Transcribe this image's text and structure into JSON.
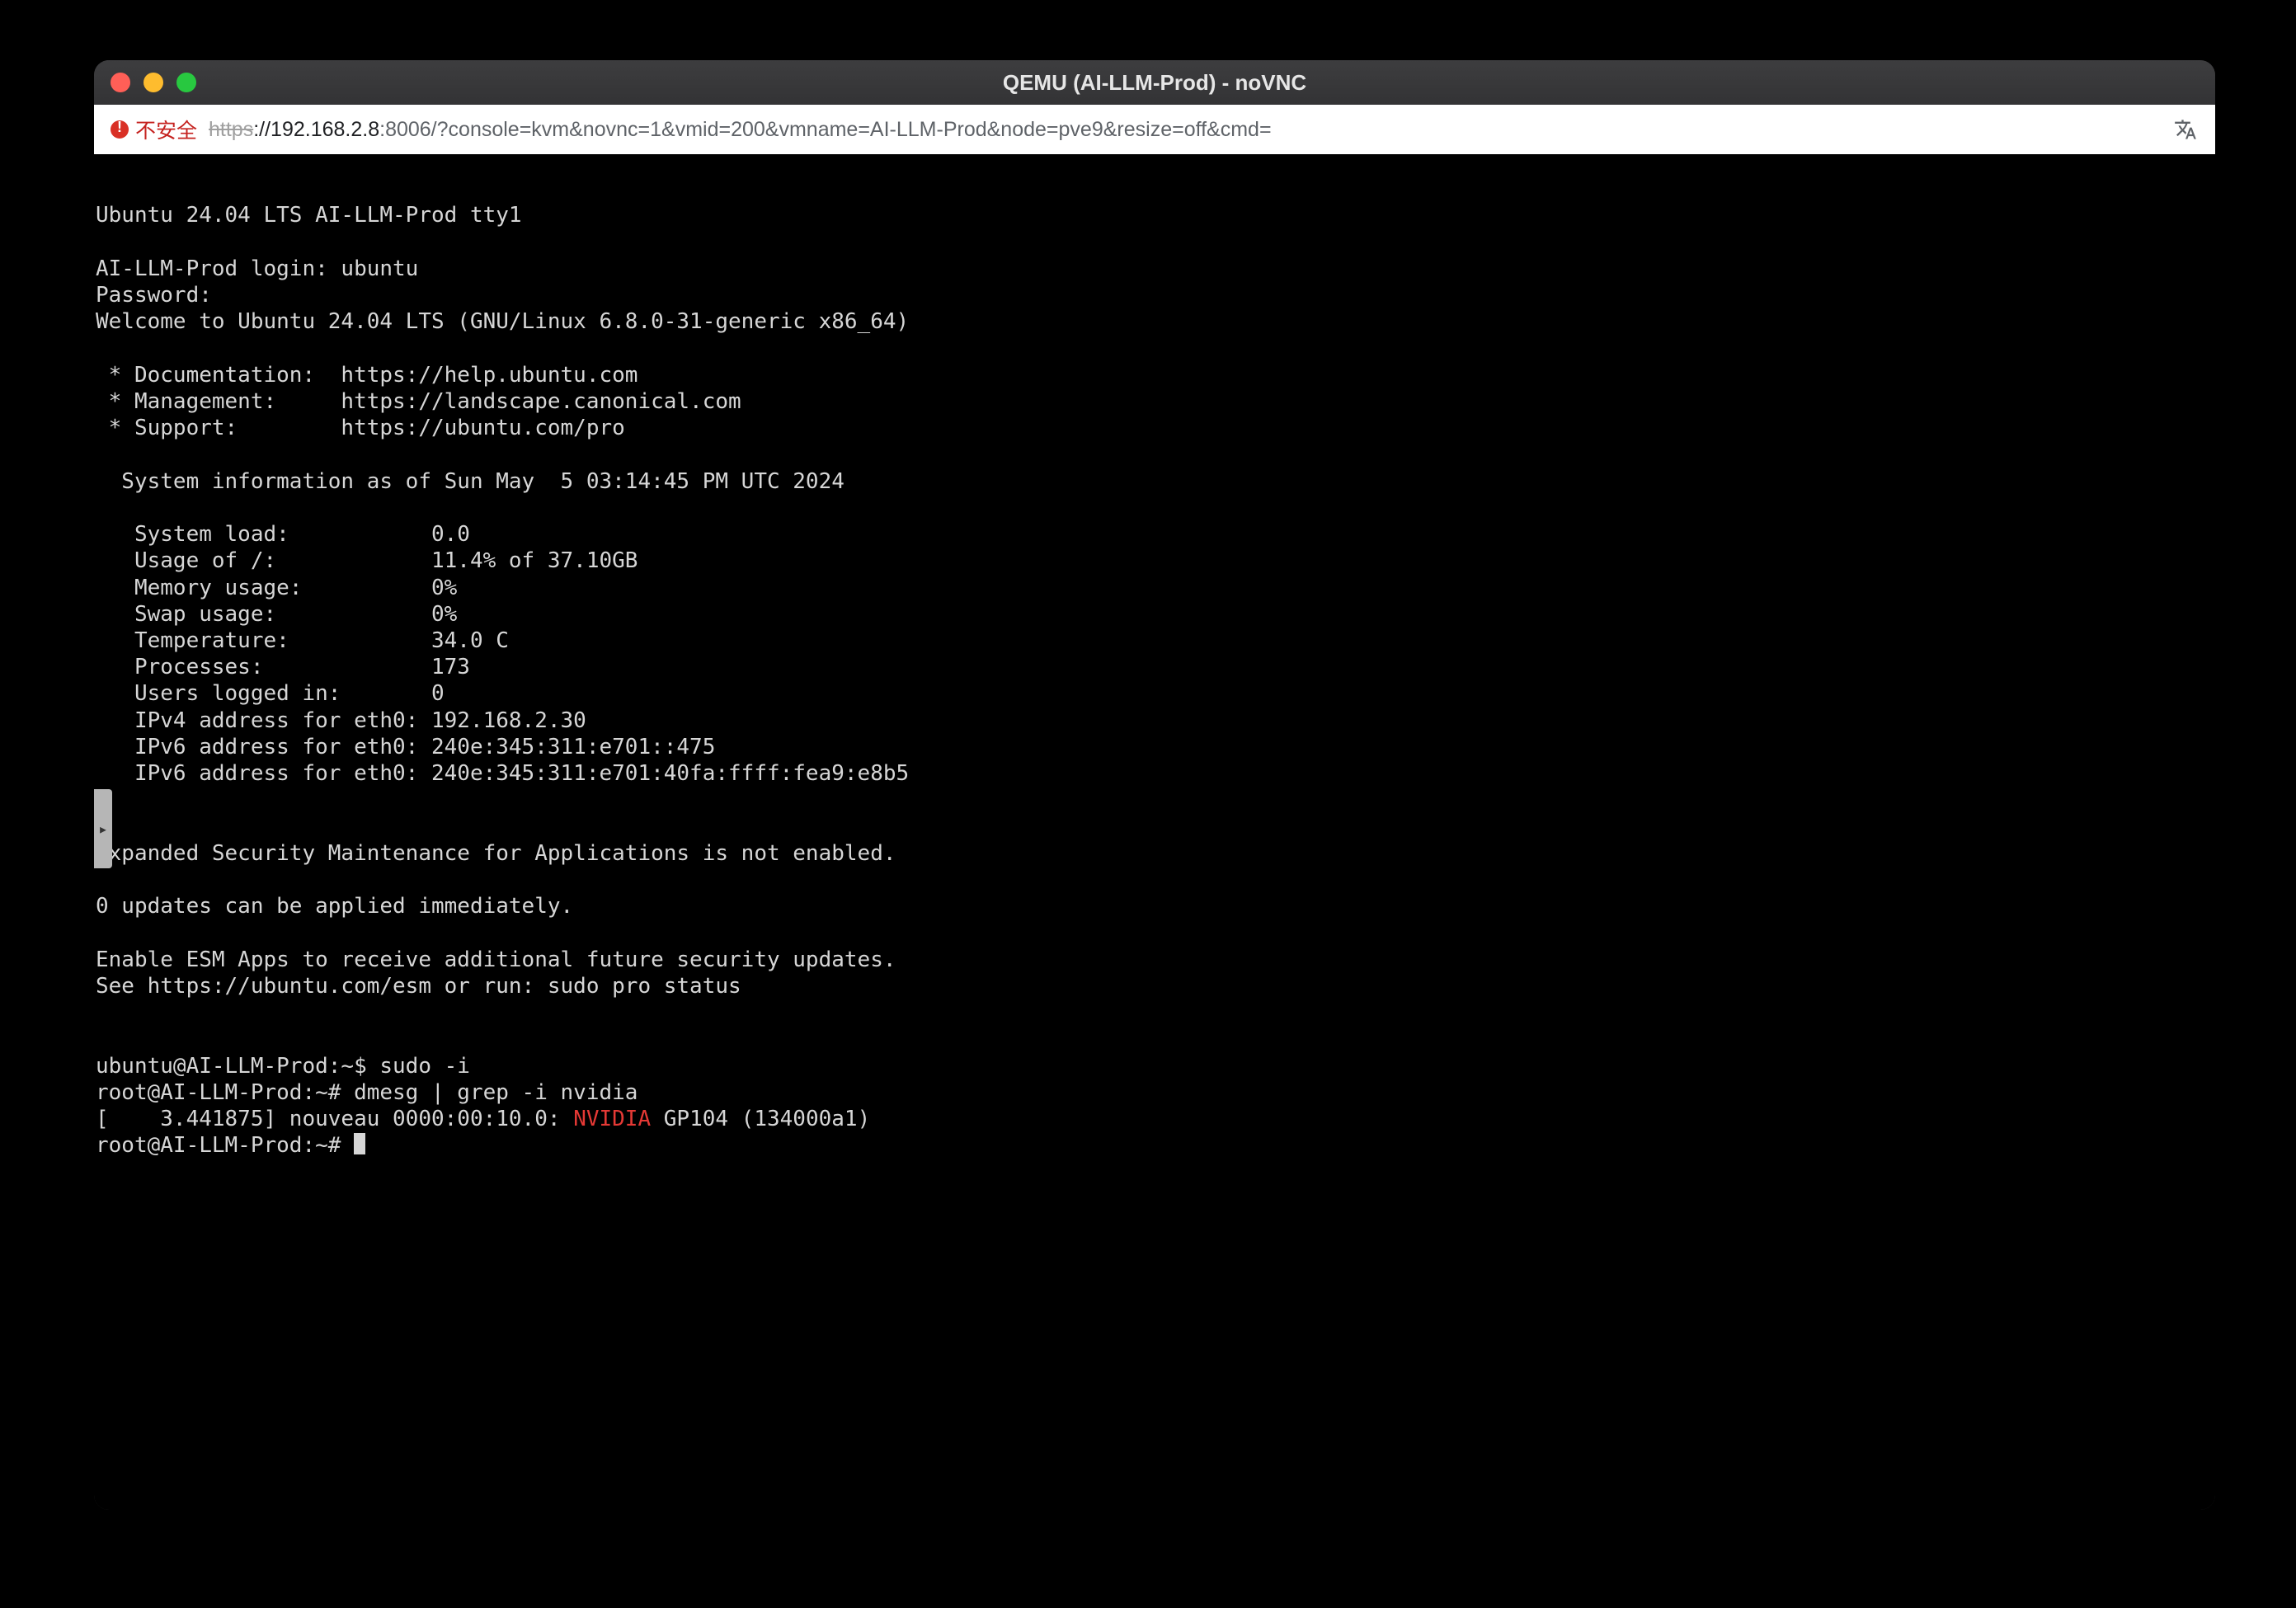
{
  "window": {
    "title": "QEMU (AI-LLM-Prod) - noVNC"
  },
  "urlbar": {
    "insecure_label": "不安全",
    "protocol": "https",
    "host": "://192.168.2.8",
    "rest": ":8006/?console=kvm&novnc=1&vmid=200&vmname=AI-LLM-Prod&node=pve9&resize=off&cmd="
  },
  "side_tab_glyph": "▸",
  "terminal": {
    "os_line": "Ubuntu 24.04 LTS AI-LLM-Prod tty1",
    "login_line": "AI-LLM-Prod login: ubuntu",
    "password_line": "Password:",
    "welcome_line": "Welcome to Ubuntu 24.04 LTS (GNU/Linux 6.8.0-31-generic x86_64)",
    "doc_line": " * Documentation:  https://help.ubuntu.com",
    "mgmt_line": " * Management:     https://landscape.canonical.com",
    "support_line": " * Support:        https://ubuntu.com/pro",
    "sysinfo_header": "  System information as of Sun May  5 03:14:45 PM UTC 2024",
    "sys_load": "   System load:           0.0",
    "sys_usage": "   Usage of /:            11.4% of 37.10GB",
    "sys_mem": "   Memory usage:          0%",
    "sys_swap": "   Swap usage:            0%",
    "sys_temp": "   Temperature:           34.0 C",
    "sys_proc": "   Processes:             173",
    "sys_users": "   Users logged in:       0",
    "sys_ipv4": "   IPv4 address for eth0: 192.168.2.30",
    "sys_ipv6a": "   IPv6 address for eth0: 240e:345:311:e701::475",
    "sys_ipv6b": "   IPv6 address for eth0: 240e:345:311:e701:40fa:ffff:fea9:e8b5",
    "esm1": "Expanded Security Maintenance for Applications is not enabled.",
    "updates": "0 updates can be applied immediately.",
    "esm2": "Enable ESM Apps to receive additional future security updates.",
    "esm3": "See https://ubuntu.com/esm or run: sudo pro status",
    "prompt1": "ubuntu@AI-LLM-Prod:~$ sudo -i",
    "prompt2": "root@AI-LLM-Prod:~# dmesg | grep -i nvidia",
    "dmesg_prefix": "[    3.441875] nouveau 0000:00:10.0: ",
    "dmesg_nvidia": "NVIDIA",
    "dmesg_suffix": " GP104 (134000a1)",
    "prompt3": "root@AI-LLM-Prod:~# "
  }
}
